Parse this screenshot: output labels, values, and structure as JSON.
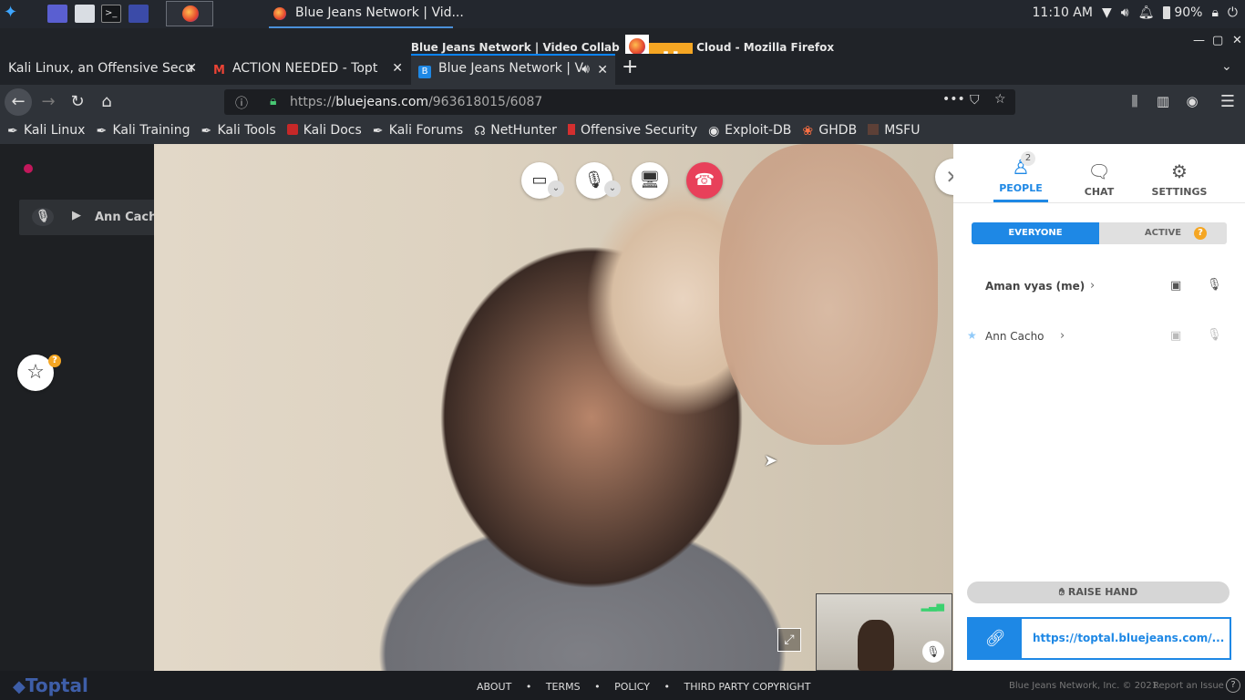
{
  "taskbar": {
    "window_title": "Blue Jeans Network | Vid...",
    "clock": "11:10 AM",
    "battery": "90%"
  },
  "window": {
    "title": "Blue Jeans Network | Video Collab",
    "title_suffix": "Cloud - Mozilla Firefox"
  },
  "tabs": [
    {
      "label": "Kali Linux, an Offensive Secu",
      "close": "✕"
    },
    {
      "label": "ACTION NEEDED - Topt",
      "close": "✕"
    },
    {
      "label": "Blue Jeans Network | V",
      "close": "✕"
    },
    {
      "label": "+"
    }
  ],
  "urlbar": {
    "url_prefix": "https://",
    "url_domain": "bluejeans.com",
    "url_path": "/963618015/6087"
  },
  "bookmarks": [
    {
      "label": "Kali Linux"
    },
    {
      "label": "Kali Training"
    },
    {
      "label": "Kali Tools"
    },
    {
      "label": "Kali Docs"
    },
    {
      "label": "Kali Forums"
    },
    {
      "label": "NetHunter"
    },
    {
      "label": "Offensive Security"
    },
    {
      "label": "Exploit-DB"
    },
    {
      "label": "GHDB"
    },
    {
      "label": "MSFU"
    }
  ],
  "meeting": {
    "talking_status": "Ann Cacho is talking",
    "favorites_badge": "?"
  },
  "sidebar": {
    "tabs": [
      {
        "label": "PEOPLE",
        "badge": "2"
      },
      {
        "label": "CHAT"
      },
      {
        "label": "SETTINGS"
      }
    ],
    "filters": {
      "everyone": "EVERYONE",
      "active": "ACTIVE",
      "active_badge": "?"
    },
    "participants": [
      {
        "name": "Aman vyas (me)"
      },
      {
        "name": "Ann Cacho"
      }
    ],
    "raise_hand": "RAISE HAND",
    "share_link": "https://toptal.bluejeans.com/..."
  },
  "footer": {
    "links": [
      "ABOUT",
      "TERMS",
      "POLICY",
      "THIRD PARTY COPYRIGHT"
    ],
    "brand": "Toptal",
    "copyright": "Blue Jeans Network, Inc. © 2021",
    "report": "Report an Issue",
    "help": "?"
  },
  "colors": {
    "accent": "#1e88e5",
    "hangup": "#e8405a",
    "recording_dot": "#c2185b"
  }
}
